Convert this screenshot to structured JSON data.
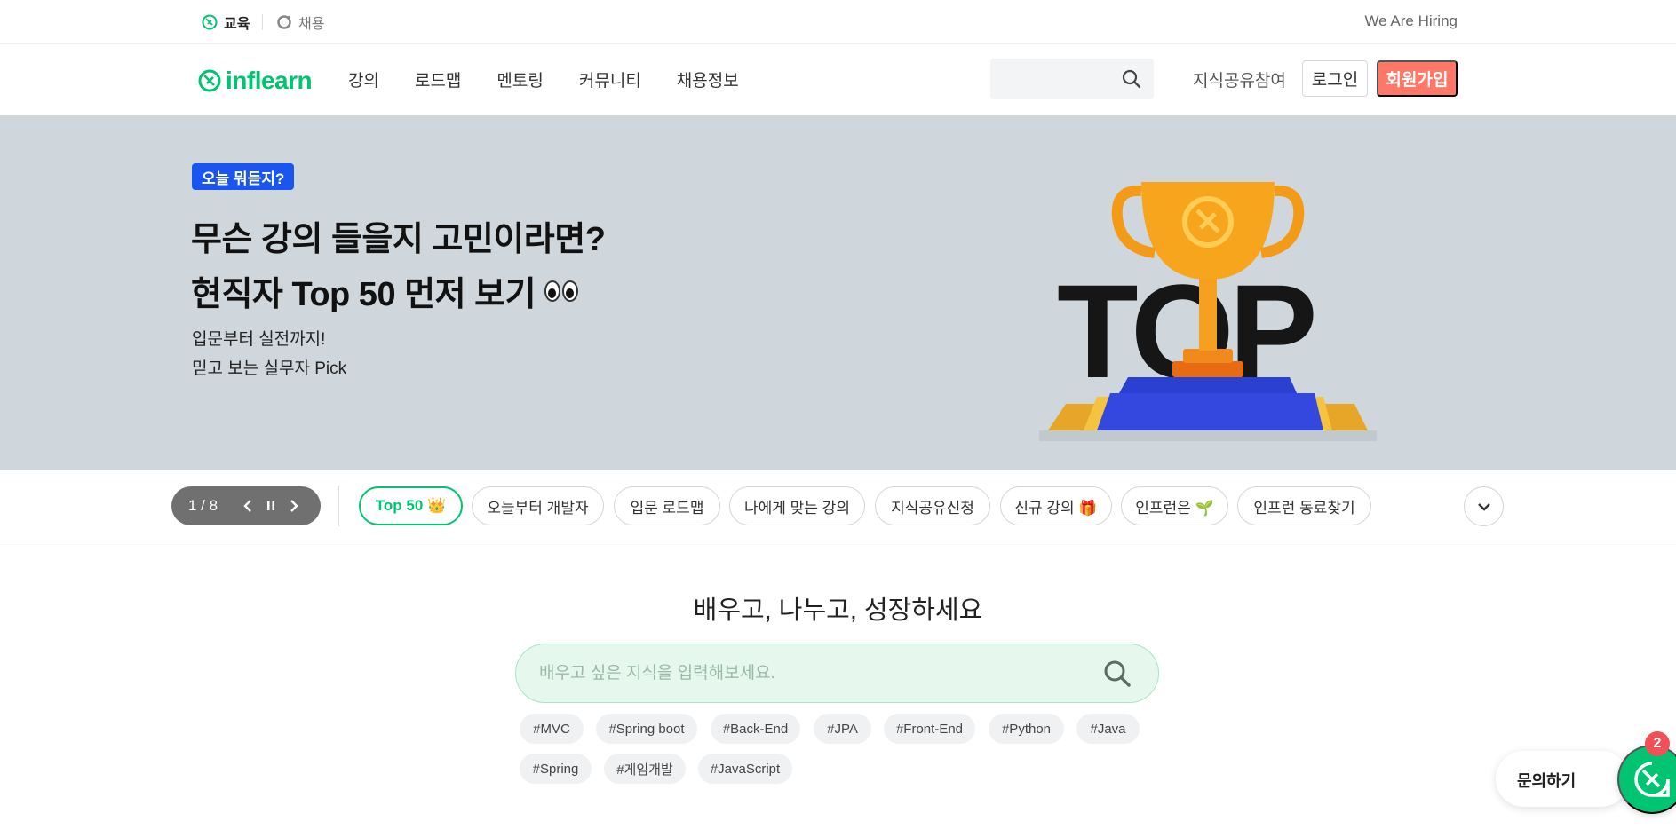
{
  "topbar": {
    "services": [
      {
        "label": "교육",
        "icon": "education-leaf-icon"
      },
      {
        "label": "채용",
        "icon": "career-icon"
      }
    ],
    "hiring": "We Are Hiring"
  },
  "header": {
    "logo": "inflearn",
    "nav": [
      "강의",
      "로드맵",
      "멘토링",
      "커뮤니티",
      "채용정보"
    ],
    "share": "지식공유참여",
    "login": "로그인",
    "signup": "회원가입"
  },
  "banner": {
    "badge": "오늘 뭐듣지?",
    "title_line1": "무슨 강의 들을지 고민이라면?",
    "title_line2": "현직자 Top 50 먼저 보기",
    "subtitle_line1": "입문부터 실전까지!",
    "subtitle_line2": "믿고 보는 실무자 Pick",
    "art_text": "TOP",
    "accent": "#1a55f0",
    "background": "#d0d7dc"
  },
  "carousel": {
    "page": "1 / 8",
    "chips": [
      {
        "label": "Top 50 👑",
        "active": true
      },
      {
        "label": "오늘부터 개발자",
        "active": false
      },
      {
        "label": "입문 로드맵",
        "active": false
      },
      {
        "label": "나에게 맞는 강의",
        "active": false
      },
      {
        "label": "지식공유신청",
        "active": false
      },
      {
        "label": "신규 강의 🎁",
        "active": false
      },
      {
        "label": "인프런은 🌱",
        "active": false
      },
      {
        "label": "인프런 동료찾기",
        "active": false
      }
    ]
  },
  "main": {
    "headline": "배우고, 나누고, 성장하세요",
    "search_placeholder": "배우고 싶은 지식을 입력해보세요.",
    "tags": [
      "#MVC",
      "#Spring boot",
      "#Back-End",
      "#JPA",
      "#Front-End",
      "#Python",
      "#Java",
      "#Spring",
      "#게임개발",
      "#JavaScript"
    ]
  },
  "chat": {
    "label": "문의하기",
    "count": "2"
  },
  "colors": {
    "brand_green": "#00c471",
    "signup_coral": "#ff7867",
    "badge_red": "#f05056"
  }
}
